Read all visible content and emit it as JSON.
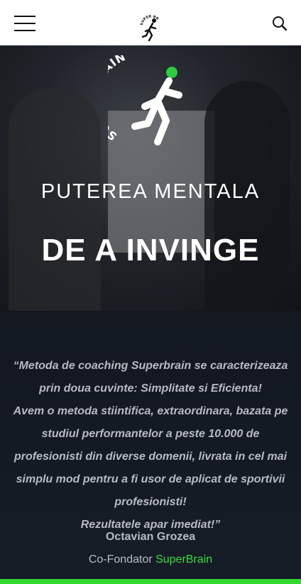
{
  "header": {
    "logo_text": "SUPER BRAIN",
    "menu_icon": "hamburger-menu-icon",
    "search_icon": "search-icon"
  },
  "hero": {
    "logo_text": "SUPER BRAIN",
    "tagline": "PUTEREA MENTALA",
    "headline": "DE A INVINGE"
  },
  "testimonial": {
    "quote_lines": [
      "“Metoda de coaching Superbrain se caracterizeaza prin doua cuvinte: Simplitate si Eficienta!",
      "Avem o metoda stiintifica, extraordinara, bazata pe studiul performantelor a peste 10.000 de profesionisti din diverse domenii, livrata in cel mai simplu mod pentru a fi usor de aplicat de sportivii profesionisti!",
      "Rezultatele apar imediat!”"
    ],
    "author": "Octavian Grozea",
    "role_prefix": "Co-Fondator ",
    "role_brand": "SuperBrain"
  },
  "colors": {
    "accent_green": "#31d92f",
    "background_dark": "#141a22",
    "text_muted": "#b7bcc4"
  }
}
